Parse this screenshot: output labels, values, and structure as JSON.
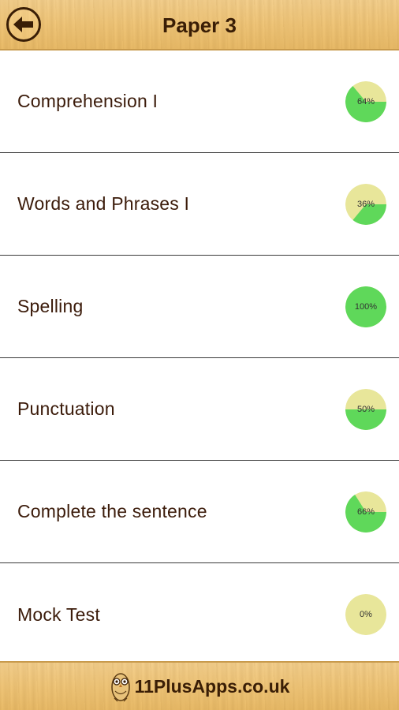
{
  "header": {
    "title": "Paper 3",
    "back_icon": "arrow-left-icon"
  },
  "colors": {
    "filled": "#5fd85a",
    "empty": "#e8e69a",
    "text": "#3b1b0a"
  },
  "items": [
    {
      "label": "Comprehension I",
      "percent_text": "64%",
      "percent": 64
    },
    {
      "label": "Words and Phrases I",
      "percent_text": "36%",
      "percent": 36
    },
    {
      "label": "Spelling",
      "percent_text": "100%",
      "percent": 100
    },
    {
      "label": "Punctuation",
      "percent_text": "50%",
      "percent": 50
    },
    {
      "label": "Complete the sentence",
      "percent_text": "66%",
      "percent": 66
    },
    {
      "label": "Mock Test",
      "percent_text": "0%",
      "percent": 0
    }
  ],
  "footer": {
    "text": "11PlusApps.co.uk",
    "logo_icon": "owl-logo-icon"
  }
}
